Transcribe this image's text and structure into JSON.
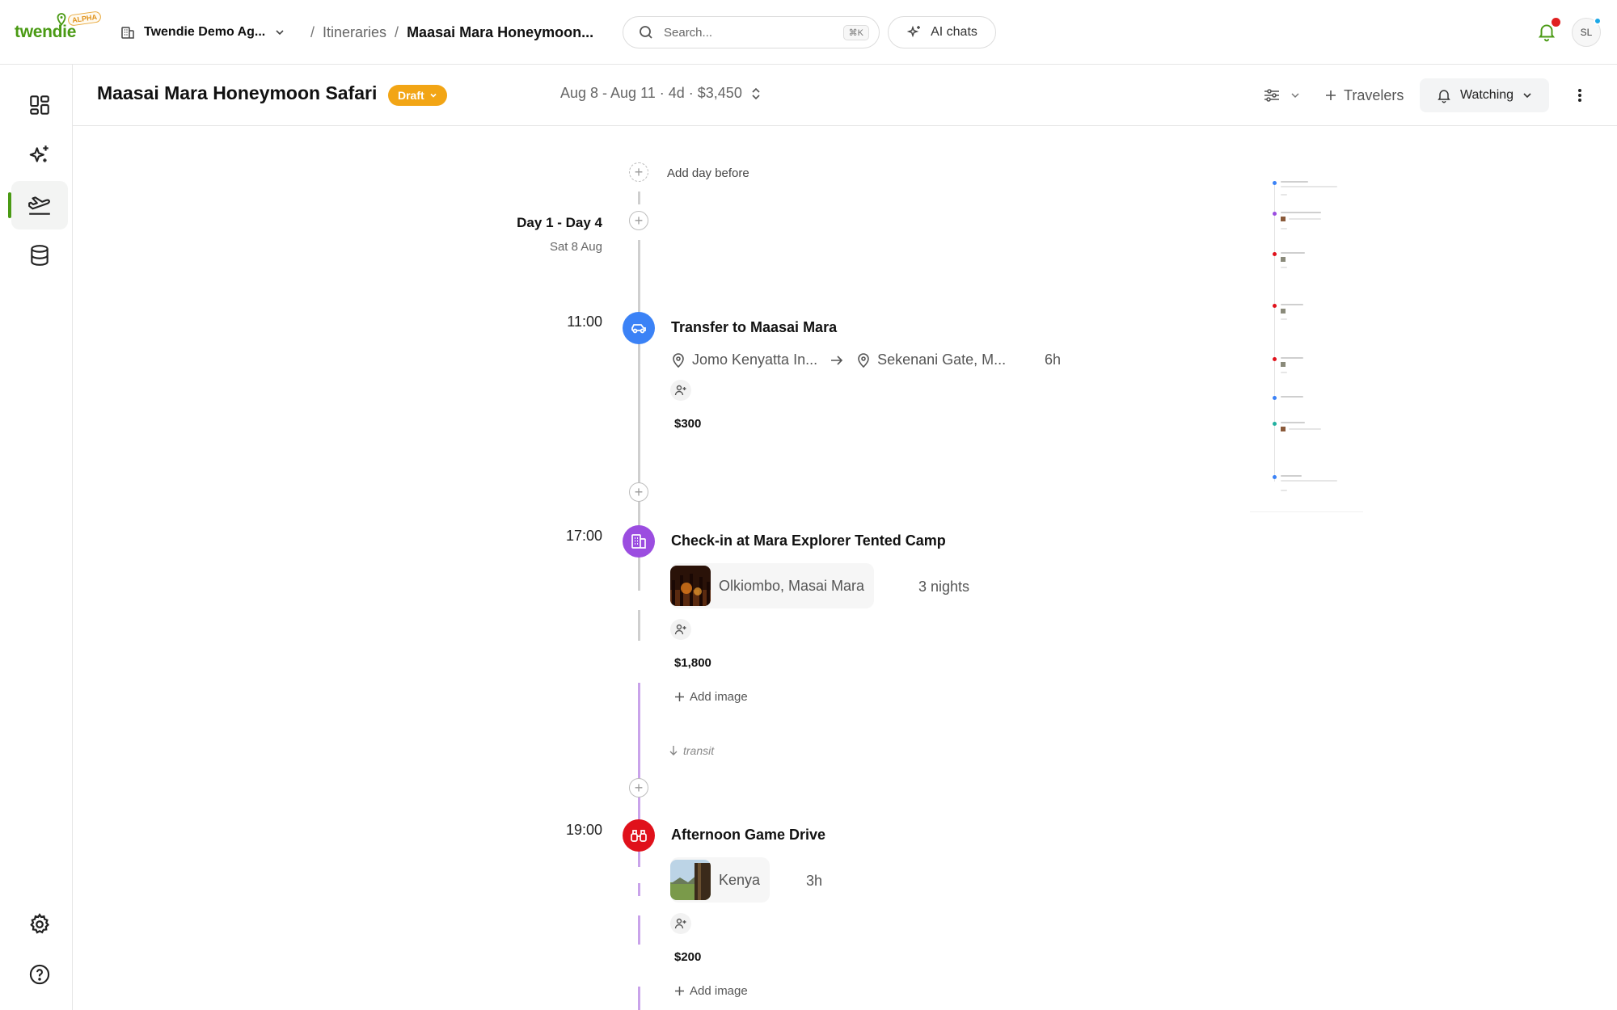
{
  "app": {
    "logo_text": "twendie",
    "logo_badge": "ALPHA",
    "workspace": "Twendie Demo Ag...",
    "breadcrumb": {
      "parent": "Itineraries",
      "current": "Maasai Mara Honeymoon..."
    },
    "search": {
      "placeholder": "Search...",
      "shortcut": "⌘K"
    },
    "ai_chats_label": "AI chats",
    "avatar_initials": "SL"
  },
  "sidebar": {
    "items": [
      {
        "name": "dashboard",
        "icon": "dashboard-grid-icon",
        "active": false
      },
      {
        "name": "ai",
        "icon": "sparkles-icon",
        "active": false
      },
      {
        "name": "itineraries",
        "icon": "plane-departure-icon",
        "active": true
      },
      {
        "name": "database",
        "icon": "database-icon",
        "active": false
      }
    ],
    "bottom": [
      {
        "name": "settings",
        "icon": "gear-icon"
      },
      {
        "name": "help",
        "icon": "help-circle-icon"
      }
    ]
  },
  "header": {
    "title": "Maasai Mara Honeymoon Safari",
    "status": "Draft",
    "meta": "Aug 8 - Aug 11 · 4d · $3,450",
    "travelers_label": "Travelers",
    "watching_label": "Watching"
  },
  "colors": {
    "brand": "#4a9a14",
    "draft": "#f2a515",
    "transfer": "#3b82f6",
    "accommodation": "#9b4de0",
    "activity": "#e0111b"
  },
  "timeline": {
    "add_day_before": "Add day before",
    "day": {
      "title": "Day 1 - Day 4",
      "date": "Sat 8 Aug"
    },
    "events": [
      {
        "time": "11:00",
        "title": "Transfer to Maasai Mara",
        "type": "transfer",
        "icon": "car-icon",
        "from": "Jomo Kenyatta In...",
        "to": "Sekenani Gate, M...",
        "duration": "6h",
        "price": "$300"
      },
      {
        "time": "17:00",
        "title": "Check-in at Mara Explorer Tented Camp",
        "type": "accommodation",
        "icon": "hotel-icon",
        "location": "Olkiombo, Masai Mara",
        "duration": "3 nights",
        "price": "$1,800",
        "add_image": "Add image",
        "transit": "transit"
      },
      {
        "time": "19:00",
        "title": "Afternoon Game Drive",
        "type": "activity",
        "icon": "binoculars-icon",
        "location": "Kenya",
        "duration": "3h",
        "price": "$200",
        "add_image": "Add image"
      }
    ]
  }
}
